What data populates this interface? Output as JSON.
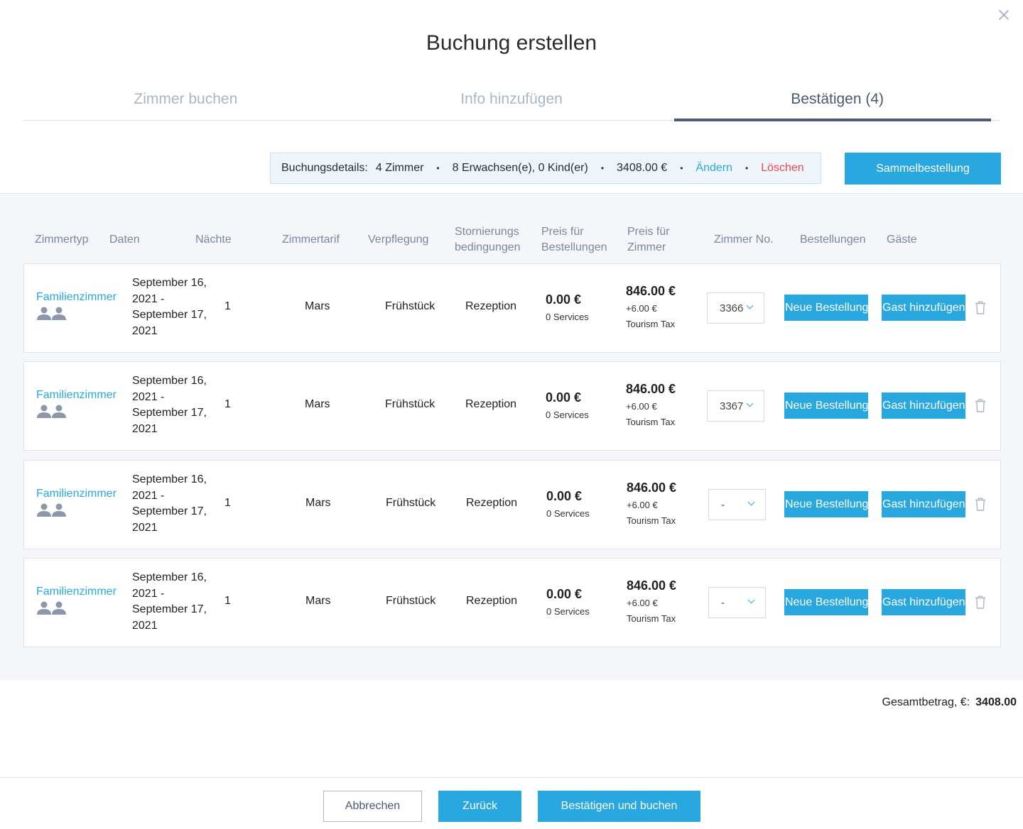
{
  "modal": {
    "title": "Buchung erstellen"
  },
  "tabs": [
    {
      "label": "Zimmer buchen",
      "active": false
    },
    {
      "label": "Info hinzufügen",
      "active": false
    },
    {
      "label": "Bestätigen (4)",
      "active": true
    }
  ],
  "details": {
    "label": "Buchungsdetails:",
    "rooms": "4 Zimmer",
    "guests": "8 Erwachsen(e), 0 Kind(er)",
    "price": "3408.00 €",
    "change": "Ändern",
    "delete": "Löschen",
    "separator": "•"
  },
  "buttons": {
    "sammel": "Sammelbestellung",
    "cancel": "Abbrechen",
    "back": "Zurück",
    "confirm": "Bestätigen und buchen"
  },
  "table": {
    "headers": {
      "zimmertyp": "Zimmertyp",
      "daten": "Daten",
      "naechte": "Nächte",
      "zimmertarif": "Zimmertarif",
      "verpflegung": "Verpflegung",
      "storno_1": "Stornierungs",
      "storno_2": "bedingungen",
      "preis_best_1": "Preis für",
      "preis_best_2": "Bestellungen",
      "preis_zimmer_1": "Preis für",
      "preis_zimmer_2": "Zimmer",
      "zimmer_no": "Zimmer No.",
      "bestellungen": "Bestellungen",
      "gaeste": "Gäste"
    },
    "rows": [
      {
        "room_type": "Familienzimmer",
        "dates_1": "September 16,",
        "dates_2": "2021 -",
        "dates_3": "September 17,",
        "dates_4": "2021",
        "nights": "1",
        "rate": "Mars",
        "meal": "Frühstück",
        "cancellation": "Rezeption",
        "order_price": "0.00 €",
        "services": "0 Services",
        "room_price": "846.00 €",
        "tax_amount": "+6.00 €",
        "tax_label": "Tourism Tax",
        "room_no": "3366",
        "new_order": "Neue Bestellung",
        "add_guest": "Gast hinzufügen"
      },
      {
        "room_type": "Familienzimmer",
        "dates_1": "September 16,",
        "dates_2": "2021 -",
        "dates_3": "September 17,",
        "dates_4": "2021",
        "nights": "1",
        "rate": "Mars",
        "meal": "Frühstück",
        "cancellation": "Rezeption",
        "order_price": "0.00 €",
        "services": "0 Services",
        "room_price": "846.00 €",
        "tax_amount": "+6.00 €",
        "tax_label": "Tourism Tax",
        "room_no": "3367",
        "new_order": "Neue Bestellung",
        "add_guest": "Gast hinzufügen"
      },
      {
        "room_type": "Familienzimmer",
        "dates_1": "September 16,",
        "dates_2": "2021 -",
        "dates_3": "September 17,",
        "dates_4": "2021",
        "nights": "1",
        "rate": "Mars",
        "meal": "Frühstück",
        "cancellation": "Rezeption",
        "order_price": "0.00 €",
        "services": "0 Services",
        "room_price": "846.00 €",
        "tax_amount": "+6.00 €",
        "tax_label": "Tourism Tax",
        "room_no": "-",
        "new_order": "Neue Bestellung",
        "add_guest": "Gast hinzufügen"
      },
      {
        "room_type": "Familienzimmer",
        "dates_1": "September 16,",
        "dates_2": "2021 -",
        "dates_3": "September 17,",
        "dates_4": "2021",
        "nights": "1",
        "rate": "Mars",
        "meal": "Frühstück",
        "cancellation": "Rezeption",
        "order_price": "0.00 €",
        "services": "0 Services",
        "room_price": "846.00 €",
        "tax_amount": "+6.00 €",
        "tax_label": "Tourism Tax",
        "room_no": "-",
        "new_order": "Neue Bestellung",
        "add_guest": "Gast hinzufügen"
      }
    ]
  },
  "total": {
    "label": "Gesamtbetrag, €:",
    "value": "3408.00"
  },
  "icons": [
    "close-icon",
    "people-icon",
    "chevron-down-icon",
    "trash-icon"
  ],
  "colors": {
    "accent": "#29a8e0",
    "danger": "#e8494f",
    "tab_active": "#4e5b76",
    "muted": "#a9b6c6"
  }
}
